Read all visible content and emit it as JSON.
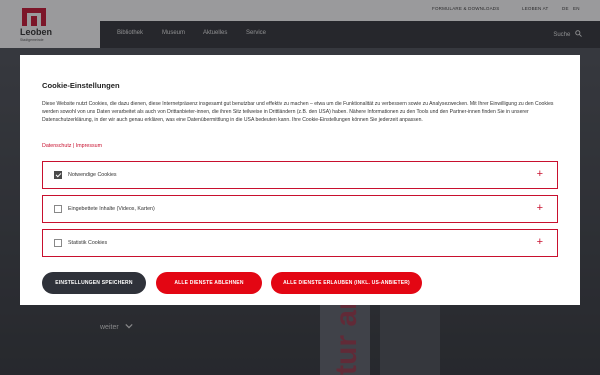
{
  "header": {
    "utility_links": [
      "FORMULARE & DOWNLOADS",
      "LEOBEN AT"
    ],
    "languages": [
      "DE",
      "EN"
    ],
    "logo_name": "Leoben",
    "logo_sub": "Stadtgemeinde"
  },
  "nav": {
    "items": [
      "Bibliothek",
      "Museum",
      "Aktuelles",
      "Service"
    ],
    "search_label": "Suche"
  },
  "hero": {
    "banner_text": "tur artien",
    "weiter_label": "weiter"
  },
  "modal": {
    "title": "Cookie-Einstellungen",
    "description": "Diese Website nutzt Cookies, die dazu dienen, diese Internetpräsenz insgesamt gut benutzbar und effektiv zu machen – etwa um die Funktionalität zu verbessern sowie zu Analysezwecken. Mit Ihrer Einwilligung zu den Cookies werden sowohl von uns Daten verarbeitet als auch von Drittanbieter-innen, die ihren Sitz teilweise in Drittländern (z.B. den USA) haben. Nähere Informationen zu den Tools und den Partner-innen finden Sie in unserer Datenschutzerklärung, in der wir auch genau erklären, was eine Datenübermittlung in die USA bedeuten kann. Ihre Cookie-Einstellungen können Sie jederzeit anpassen.",
    "link_datenschutz": "Datenschutz",
    "link_separator": " | ",
    "link_impressum": "Impressum",
    "options": [
      {
        "label": "Notwendige Cookies",
        "checked": true
      },
      {
        "label": "Eingebettete Inhalte (Videos, Karten)",
        "checked": false
      },
      {
        "label": "Statistik Cookies",
        "checked": false
      }
    ],
    "expand_symbol": "+",
    "buttons": {
      "save": "EINSTELLUNGEN SPEICHERN",
      "reject_all": "ALLE DIENSTE ABLEHNEN",
      "accept_all": "ALLE DIENSTE ERLAUBEN (INKL. US-ANBIETER)"
    }
  },
  "colors": {
    "accent": "#c8102e",
    "button_red": "#e30613",
    "button_dark": "#2f323a"
  }
}
